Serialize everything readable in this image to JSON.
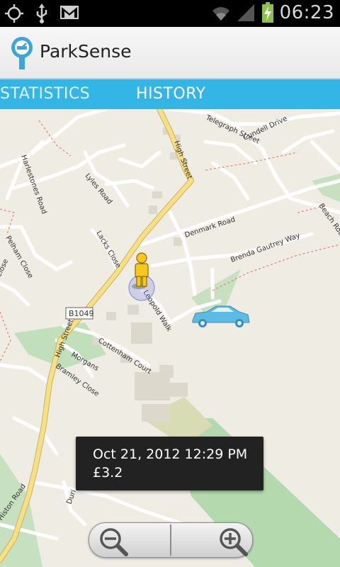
{
  "status_bar": {
    "time": "06:23",
    "icons": [
      "gps-icon",
      "usb-icon",
      "gmail-icon",
      "wifi-icon",
      "signal-icon",
      "battery-charging-icon"
    ]
  },
  "action_bar": {
    "app_title": "ParkSense",
    "logo_icon": "parking-meter-icon"
  },
  "tabs": [
    {
      "label": "STATISTICS",
      "selected": false
    },
    {
      "label": "HISTORY",
      "selected": true
    }
  ],
  "map": {
    "road_labels": {
      "telegraph": "Telegraph Street",
      "cundell": "Cundell Drive",
      "high_street_top": "High Street",
      "harlestones": "Harlestones Road",
      "lyles": "Lyles Road",
      "beach": "Beach Road",
      "denmark": "Denmark Road",
      "pelham": "Pelham Close",
      "lacks": "Lacks Close",
      "brenda": "Brenda Gautrey Way",
      "close_left": "Close",
      "leopold": "Leopold Walk",
      "b1049": "B1049",
      "high_street_bottom": "High Street",
      "cottenham": "Cottenham Court",
      "morgans": "Morgans",
      "bramley": "Bramley Close",
      "histon": "Histon Road",
      "durn": "Duri"
    },
    "markers": [
      "pegman-icon",
      "car-icon"
    ]
  },
  "tooltip": {
    "datetime": "Oct 21, 2012 12:29 PM",
    "amount": "£3.2"
  },
  "zoom": {
    "out_icon": "zoom-out-icon",
    "in_icon": "zoom-in-icon"
  },
  "colors": {
    "tab_bar": "#33b5e5",
    "tooltip_bg": "#222222",
    "map_bg": "#f0ede5",
    "main_road": "#f4d97a",
    "park": "#b9dcb4",
    "car": "#5bbbe4"
  }
}
